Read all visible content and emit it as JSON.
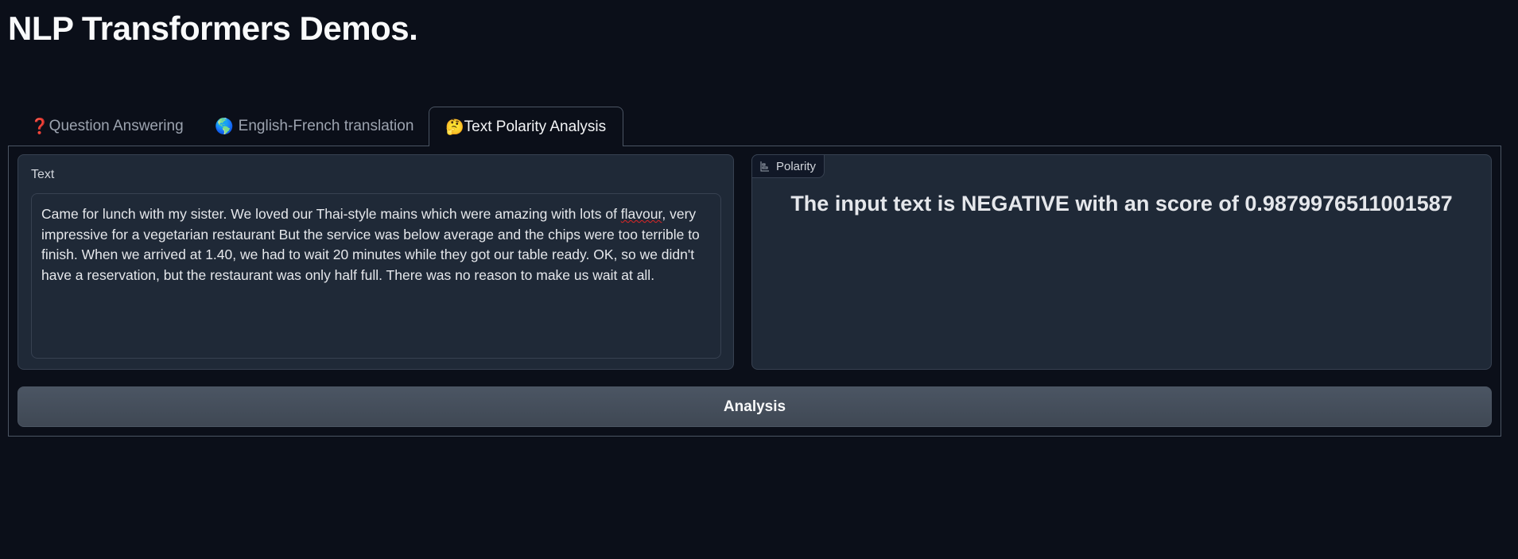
{
  "header": {
    "title": "NLP Transformers Demos."
  },
  "tabs": [
    {
      "icon": "❓",
      "label": "Question Answering"
    },
    {
      "icon": "🌎",
      "label": "English-French translation"
    },
    {
      "icon": "🤔",
      "label": "Text Polarity Analysis"
    }
  ],
  "input": {
    "label": "Text",
    "value_parts": [
      "Came for lunch with my sister. We loved our Thai-style mains which were amazing with lots of ",
      "flavour",
      ", very impressive for a vegetarian restaurant But the service was below average and the chips were too terrible to finish. When we arrived at 1.40, we had to wait 20 minutes while they got our table ready. OK, so we didn't have a reservation, but the restaurant was only half full. There was no reason to make us wait at all."
    ]
  },
  "output": {
    "label": "Polarity",
    "result": "The input text is NEGATIVE with an score of 0.9879976511001587"
  },
  "button": {
    "label": "Analysis"
  }
}
